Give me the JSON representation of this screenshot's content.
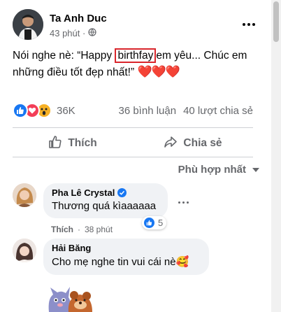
{
  "post": {
    "author": "Ta Anh Duc",
    "time": "43 phút ·",
    "privacy_icon": "globe-icon",
    "text_before": "Nói nghe nè: “Happy ",
    "highlighted_word": "birthfay",
    "text_after": "em yêu... Chúc em những điều tốt đẹp nhất!” ",
    "hearts": "❤️❤️❤️"
  },
  "stats": {
    "reactions_count": "36K",
    "comments": "36 bình luận",
    "shares": "40 lượt chia sẻ"
  },
  "actions": {
    "like_label": "Thích",
    "share_label": "Chia sẻ"
  },
  "sort": {
    "label": "Phù hợp nhất"
  },
  "comments": [
    {
      "name": "Pha Lê Crystal",
      "verified": true,
      "text": "Thương quá kìaaaaaa",
      "like_label": "Thích",
      "time": "38 phút",
      "reaction_count": "5"
    },
    {
      "name": "Hải Băng",
      "text": "Cho mẹ nghe tin vui cái nè🥰"
    }
  ],
  "colors": {
    "accent": "#1877f2",
    "highlight_border": "#d9262c",
    "secondary_text": "#65676b",
    "bubble": "#f0f2f5"
  }
}
